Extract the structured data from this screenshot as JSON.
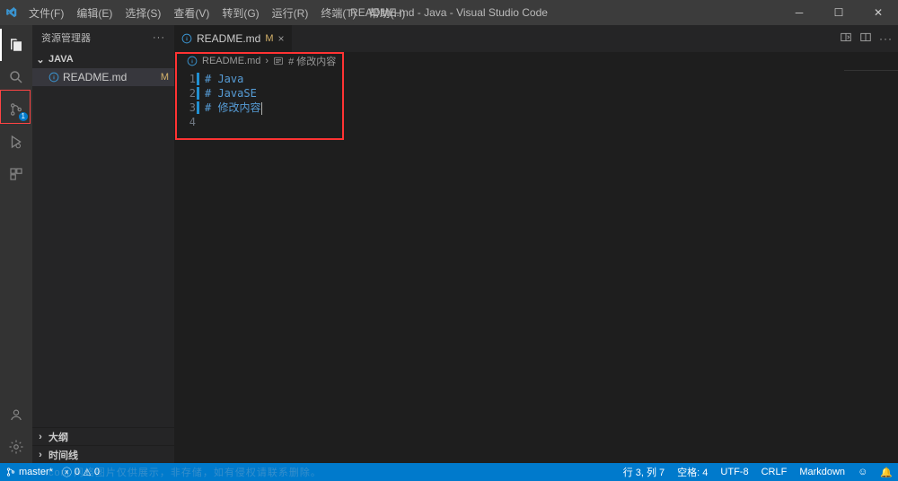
{
  "titlebar": {
    "menus": [
      "文件(F)",
      "编辑(E)",
      "选择(S)",
      "查看(V)",
      "转到(G)",
      "运行(R)",
      "终端(T)",
      "帮助(H)"
    ],
    "title": "README.md - Java - Visual Studio Code"
  },
  "activitybar": {
    "scm_badge": "1"
  },
  "sidebar": {
    "header": "资源管理器",
    "root": "JAVA",
    "file": {
      "name": "README.md",
      "modifier": "M"
    },
    "outline": "大纲",
    "timeline": "时间线"
  },
  "editor": {
    "tab_name": "README.md",
    "tab_modifier": "M",
    "breadcrumb": {
      "file": "README.md",
      "section": "# 修改内容"
    },
    "lines": [
      {
        "num": "1",
        "text": "# Java"
      },
      {
        "num": "2",
        "text": "# JavaSE"
      },
      {
        "num": "3",
        "text": "# 修改内容"
      },
      {
        "num": "4",
        "text": ""
      }
    ]
  },
  "statusbar": {
    "branch": "master*",
    "errors": "0",
    "warnings": "0",
    "position": "行 3, 列 7",
    "spaces": "空格: 4",
    "encoding": "UTF-8",
    "eol": "CRLF",
    "lang": "Markdown",
    "feedback_icon": "☺",
    "bell_icon": "🔔"
  },
  "watermark": ".com 网络图片仅供展示，非存储，如有侵权请联系删除。"
}
